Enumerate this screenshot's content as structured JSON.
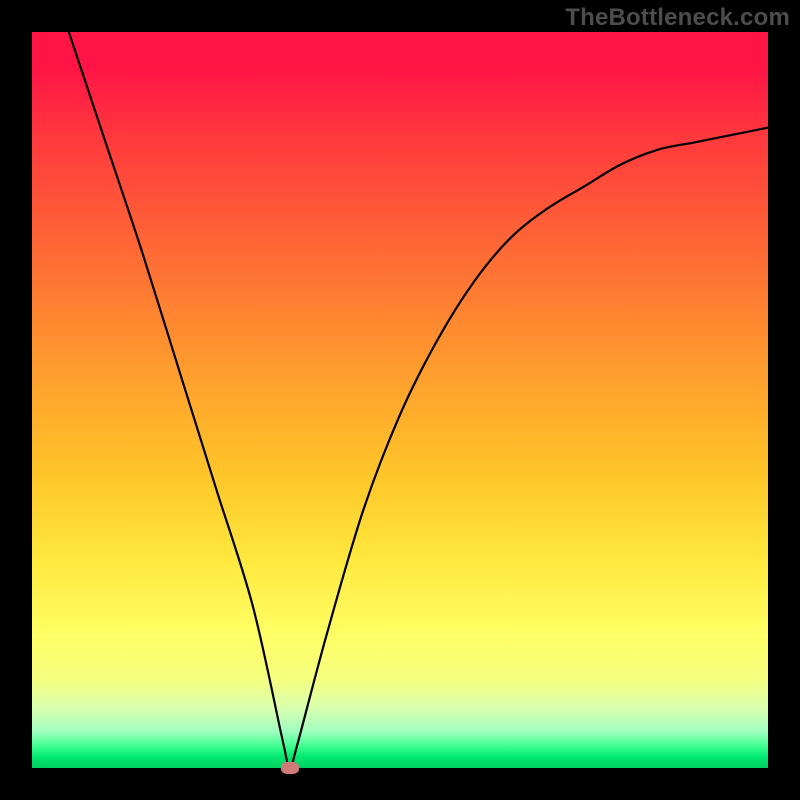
{
  "watermark": "TheBottleneck.com",
  "chart_data": {
    "type": "line",
    "title": "",
    "xlabel": "",
    "ylabel": "",
    "xlim": [
      0,
      100
    ],
    "ylim": [
      0,
      100
    ],
    "grid": false,
    "legend": false,
    "series": [
      {
        "name": "bottleneck-curve",
        "x": [
          5,
          10,
          15,
          20,
          25,
          30,
          34,
          35,
          36,
          40,
          45,
          50,
          55,
          60,
          65,
          70,
          75,
          80,
          85,
          90,
          95,
          100
        ],
        "y": [
          100,
          85,
          70,
          54,
          38,
          22,
          4,
          0,
          3,
          18,
          35,
          48,
          58,
          66,
          72,
          76,
          79,
          82,
          84,
          85,
          86,
          87
        ]
      }
    ],
    "marker": {
      "x": 35,
      "y": 0,
      "color": "#d07a7a"
    },
    "background": "rainbow-vertical-gradient"
  }
}
